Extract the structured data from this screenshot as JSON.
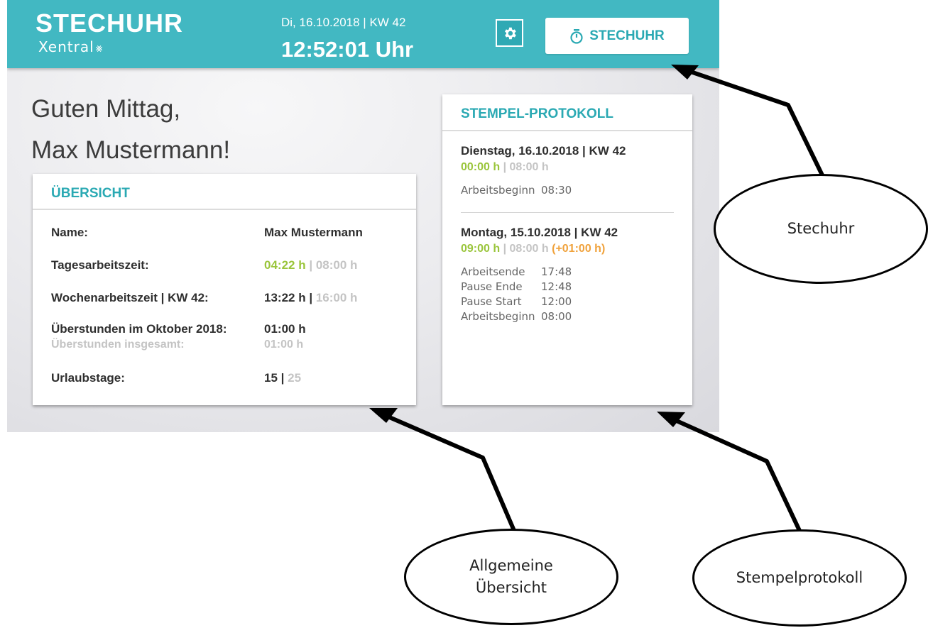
{
  "header": {
    "title": "STECHUHR",
    "brand": "Xentral",
    "brand_icon": "x-star-icon",
    "date": "Di, 16.10.2018 | KW 42",
    "time": "12:52:01 Uhr",
    "settings_icon": "gear-icon",
    "stechuhr_button": "STECHUHR",
    "stechuhr_icon": "stopwatch-icon"
  },
  "greeting": {
    "line1": "Guten Mittag,",
    "line2": "Max Mustermann!"
  },
  "overview": {
    "title": "ÜBERSICHT",
    "name_label": "Name:",
    "name_value": "Max Mustermann",
    "daily_label": "Tagesarbeitszeit:",
    "daily_value": "04:22 h",
    "daily_target": "08:00 h",
    "weekly_label": "Wochenarbeitszeit | KW 42:",
    "weekly_value": "13:22 h",
    "weekly_target": "16:00 h",
    "overtime_month_label": "Überstunden im Oktober 2018:",
    "overtime_month_value": "01:00 h",
    "overtime_total_label": "Überstunden insgesamt:",
    "overtime_total_value": "01:00 h",
    "vacation_label": "Urlaubstage:",
    "vacation_value": "15",
    "vacation_total": "25",
    "separator": "|"
  },
  "protocol": {
    "title": "STEMPEL-PROTOKOLL",
    "days": [
      {
        "heading": "Dienstag, 16.10.2018 | KW 42",
        "worked": "00:00 h",
        "target": "08:00 h",
        "overtime": "",
        "entries": [
          {
            "label": "Arbeitsbeginn",
            "time": "08:30"
          }
        ]
      },
      {
        "heading": "Montag, 15.10.2018 | KW 42",
        "worked": "09:00 h",
        "target": "08:00 h",
        "overtime": "(+01:00 h)",
        "entries": [
          {
            "label": "Arbeitsende",
            "time": "17:48"
          },
          {
            "label": "Pause Ende",
            "time": "12:48"
          },
          {
            "label": "Pause Start",
            "time": "12:00"
          },
          {
            "label": "Arbeitsbeginn",
            "time": "08:00"
          }
        ]
      }
    ]
  },
  "callouts": {
    "stechuhr": "Stechuhr",
    "overview_line1": "Allgemeine",
    "overview_line2": "Übersicht",
    "protocol": "Stempelprotokoll"
  },
  "colors": {
    "header": "#42b8c2",
    "accent": "#2aa9b3",
    "green": "#9ac53b",
    "orange": "#f0a23c"
  }
}
